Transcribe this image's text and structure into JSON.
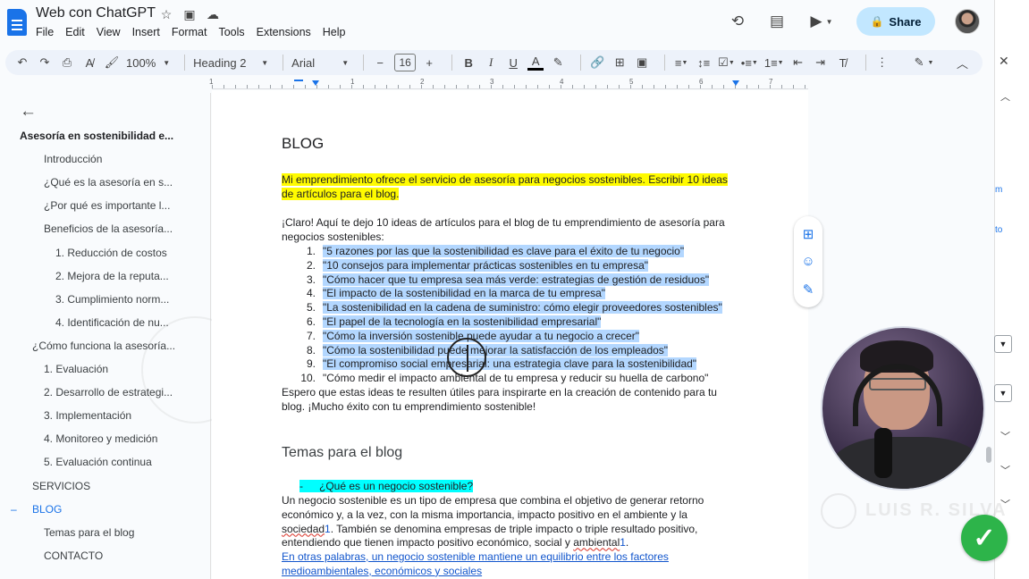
{
  "app": {
    "title": "Web con ChatGPT",
    "menu": [
      "File",
      "Edit",
      "View",
      "Insert",
      "Format",
      "Tools",
      "Extensions",
      "Help"
    ],
    "share_label": "Share"
  },
  "toolbar": {
    "zoom": "100%",
    "style": "Heading 2",
    "font": "Arial",
    "font_size": "16"
  },
  "ruler": {
    "numbers": [
      "1",
      "1",
      "2",
      "3",
      "4",
      "5",
      "6",
      "7"
    ]
  },
  "outline": {
    "items": [
      {
        "label": "Asesoría en sostenibilidad e...",
        "level": 0
      },
      {
        "label": "Introducción",
        "level": 2
      },
      {
        "label": "¿Qué es la asesoría en s...",
        "level": 2
      },
      {
        "label": "¿Por qué es importante l...",
        "level": 2
      },
      {
        "label": "Beneficios de la asesoría...",
        "level": 2
      },
      {
        "label": "1. Reducción de costos",
        "level": 3
      },
      {
        "label": "2. Mejora de la reputa...",
        "level": 3
      },
      {
        "label": "3. Cumplimiento norm...",
        "level": 3
      },
      {
        "label": "4. Identificación de nu...",
        "level": 3
      },
      {
        "label": "¿Cómo funciona la asesoría...",
        "level": 1
      },
      {
        "label": "1. Evaluación",
        "level": 2
      },
      {
        "label": "2. Desarrollo de estrategi...",
        "level": 2
      },
      {
        "label": "3. Implementación",
        "level": 2
      },
      {
        "label": "4. Monitoreo y medición",
        "level": 2
      },
      {
        "label": "5. Evaluación continua",
        "level": 2
      },
      {
        "label": "SERVICIOS",
        "level": 1
      },
      {
        "label": "BLOG",
        "level": 1
      },
      {
        "label": "Temas para el blog",
        "level": 2
      },
      {
        "label": "CONTACTO",
        "level": 2
      }
    ]
  },
  "document": {
    "heading": "BLOG",
    "prompt_line1": "Mi emprendimiento ofrece el servicio de asesoría para negocios sostenibles. Escribir 10 ideas",
    "prompt_line2": "de artículos para el blog.",
    "intro_line1": "¡Claro! Aquí te dejo 10 ideas de artículos para el blog de tu emprendimiento de asesoría para",
    "intro_line2": "negocios sostenibles:",
    "ideas": [
      {
        "n": "1.",
        "text": "\"5 razones por las que la sostenibilidad es clave para el éxito de tu negocio\""
      },
      {
        "n": "2.",
        "text": "\"10 consejos para implementar prácticas sostenibles en tu empresa\""
      },
      {
        "n": "3.",
        "text": "\"Cómo hacer que tu empresa sea más verde: estrategias de gestión de residuos\""
      },
      {
        "n": "4.",
        "text": "\"El impacto de la sostenibilidad en la marca de tu empresa\""
      },
      {
        "n": "5.",
        "text": "\"La sostenibilidad en la cadena de suministro: cómo elegir proveedores sostenibles\""
      },
      {
        "n": "6.",
        "text": "\"El papel de la tecnología en la sostenibilidad empresarial\""
      },
      {
        "n": "7.",
        "text": "\"Cómo la inversión sostenible puede ayudar a tu negocio a crecer\""
      },
      {
        "n": "8.",
        "text": "\"Cómo la sostenibilidad puede mejorar la satisfacción de los empleados\""
      },
      {
        "n": "9.",
        "text": "\"El compromiso social empresarial: una estrategia clave para la sostenibilidad\""
      },
      {
        "n": "10.",
        "text": "\"Cómo medir el impacto ambiental de tu empresa y reducir su huella de carbono\""
      }
    ],
    "closing_line1": "Espero que estas ideas te resulten útiles para inspirarte en la creación de contenido para tu",
    "closing_line2": "blog. ¡Mucho éxito con tu emprendimiento sostenible!",
    "section_heading": "Temas para el blog",
    "bullet_dash": "-",
    "bullet_question": "¿Qué es un negocio sostenible?",
    "def_line1": "Un negocio sostenible es un tipo de empresa que combina el objetivo de generar retorno",
    "def_line2": "económico y, a la vez, con la misma importancia, impacto positivo en el ambiente y la",
    "def_line3_a": "sociedad",
    "def_line3_sup": "1",
    "def_line3_b": ". También se denomina empresas de triple impacto o triple resultado positivo,",
    "def_line4_a": "entendiendo que tienen impacto positivo económico, social y ",
    "def_line4_b": "ambiental",
    "def_line4_sup": "1",
    "def_line4_c": ".",
    "link_line1": "En otras palabras, un negocio sostenible mantiene un equilibrio entre los factores",
    "link_line2": "medioambientales, económicos y sociales"
  },
  "watermark": {
    "text": "LUIS R. SILVA"
  },
  "colors": {
    "accent": "#1a73e8",
    "highlight_yellow": "#fffb00",
    "highlight_blue": "#b3d7ff",
    "highlight_cyan": "#00ffff",
    "check": "#2db44a"
  }
}
